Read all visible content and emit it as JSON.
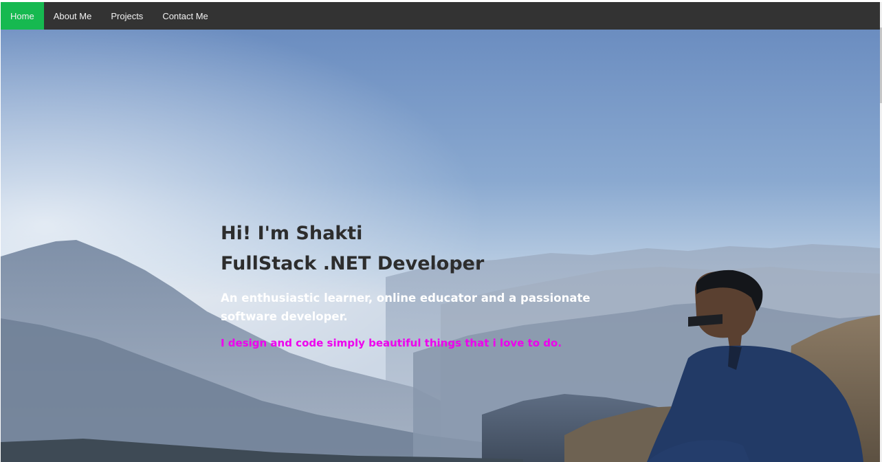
{
  "nav": {
    "items": [
      {
        "label": "Home",
        "active": true
      },
      {
        "label": "About Me",
        "active": false
      },
      {
        "label": "Projects",
        "active": false
      },
      {
        "label": "Contact Me",
        "active": false
      }
    ],
    "bg_color": "#333333",
    "active_color": "#16b950"
  },
  "hero": {
    "greeting": "Hi! I'm Shakti",
    "role": "FullStack .NET Developer",
    "tagline": "An enthusiastic learner, online educator and a passionate software developer.",
    "motto": "I design and code simply beautiful things that i love to do.",
    "motto_color": "#ee00ee",
    "background_image": "mountain-landscape-photo"
  }
}
